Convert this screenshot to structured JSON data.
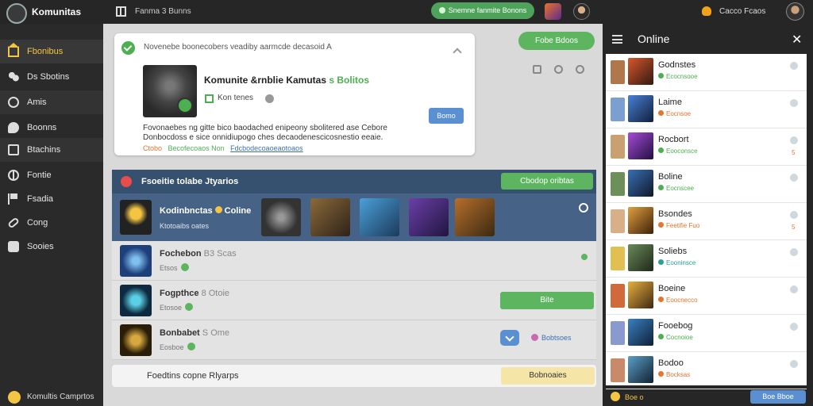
{
  "topbar": {
    "logo": "Komunitas",
    "menu": "Fanma 3 Bunns",
    "cta": "Snemne fanmite Bonons",
    "right_label": "Cacco Fcaos"
  },
  "sidebar": {
    "items": [
      {
        "label": "Fbonibus",
        "icon": "home-icon"
      },
      {
        "label": "Ds Sbotins",
        "icon": "people-icon"
      },
      {
        "label": "Amis",
        "icon": "ring-icon"
      },
      {
        "label": "Boonns",
        "icon": "chat-icon"
      },
      {
        "label": "Btachins",
        "icon": "box-icon"
      },
      {
        "label": "Fontie",
        "icon": "globe-icon"
      },
      {
        "label": "Fsadia",
        "icon": "flag-icon"
      },
      {
        "label": "Cong",
        "icon": "link-icon"
      },
      {
        "label": "Sooies",
        "icon": "puzzle-icon"
      }
    ],
    "footer": "Komultis Camprtos"
  },
  "notice": {
    "title": "Novenebe boonecobers veadiby aarmcde decasoid A",
    "heading": "Komunite &rnblie Kamutas",
    "heading_accent": "s Bolitos",
    "sub": "Kon tenes",
    "body": "Fovonaebes ng gitte bico baodached enipeony sbolitered ase Cebore Donbocdoss e sice onnidiupogo ches decaodenescicosnestio eeaie.",
    "button": "Bomo",
    "link_orange": "Ctobo",
    "link_green": "Becofecoaos Non",
    "link_blue": "Fdcbodecoaoeaotoaos"
  },
  "rate_button": "Fobe Bdoos",
  "section": {
    "title": "Fsoeitie tolabe Jtyarios",
    "button": "Cbodop oribtas"
  },
  "featured": {
    "title": "Kodinbnctas",
    "title_after": "Coline",
    "sub": "Ktotoaibs oates"
  },
  "rows": [
    {
      "title": "Fochebon",
      "muted": "B3 Scas",
      "sub": "Etsos"
    },
    {
      "title": "Fogpthce",
      "muted": "8 Otoie",
      "sub": "Etosoe",
      "button": "Bite"
    },
    {
      "title": "Bonbabet",
      "muted": "S Ome",
      "sub": "Eosboe",
      "link": "Bobtsoes"
    }
  ],
  "bottom": {
    "label": "Foedtins copne Rlyarps",
    "button": "Bobnoaies"
  },
  "online": {
    "title": "Online",
    "users": [
      {
        "name": "Godnstes",
        "status": "Ecocnsooe",
        "tone": "green",
        "count": ""
      },
      {
        "name": "Laime",
        "status": "Eocnsoe",
        "tone": "orange",
        "count": ""
      },
      {
        "name": "Rocbort",
        "status": "Eooconsce",
        "tone": "green",
        "count": "5"
      },
      {
        "name": "Boline",
        "status": "Eocnscee",
        "tone": "green",
        "count": ""
      },
      {
        "name": "Bsondes",
        "status": "Feetifie Fuo",
        "tone": "orange",
        "count": "5"
      },
      {
        "name": "Soliebs",
        "status": "Eooninsce",
        "tone": "teal",
        "count": ""
      },
      {
        "name": "Boeine",
        "status": "Eoocnecco",
        "tone": "orange",
        "count": ""
      },
      {
        "name": "Fooebog",
        "status": "Cocnoioe",
        "tone": "green",
        "count": ""
      },
      {
        "name": "Bodoo",
        "status": "Bocksas",
        "tone": "orange",
        "count": ""
      }
    ],
    "footer_label": "Boe o",
    "footer_button": "Boe Bboe"
  }
}
